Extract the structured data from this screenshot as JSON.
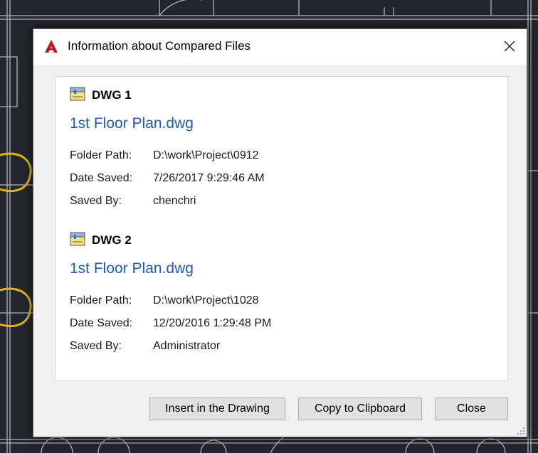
{
  "dialog": {
    "title": "Information about Compared Files",
    "close_glyph": "✕",
    "app_icon": "autocad-a-icon"
  },
  "files": [
    {
      "header": "DWG 1",
      "icon": "dwg-file-icon",
      "filename": "1st Floor Plan.dwg",
      "folder_label": "Folder Path:",
      "folder_value": "D:\\work\\Project\\0912",
      "date_label": "Date Saved:",
      "date_value": "7/26/2017 9:29:46 AM",
      "saved_by_label": "Saved By:",
      "saved_by_value": "chenchri"
    },
    {
      "header": "DWG 2",
      "icon": "dwg-file-icon",
      "filename": "1st Floor Plan.dwg",
      "folder_label": "Folder Path:",
      "folder_value": "D:\\work\\Project\\1028",
      "date_label": "Date Saved:",
      "date_value": "12/20/2016 1:29:48 PM",
      "saved_by_label": "Saved By:",
      "saved_by_value": "Administrator"
    }
  ],
  "buttons": {
    "insert": "Insert in the Drawing",
    "copy": "Copy to Clipboard",
    "close": "Close"
  },
  "colors": {
    "link": "#1c5bc4",
    "brand_red": "#c8102e",
    "background": "#22272e",
    "cad_lines": "#c9ccd1",
    "cad_highlight": "#e8b400"
  }
}
